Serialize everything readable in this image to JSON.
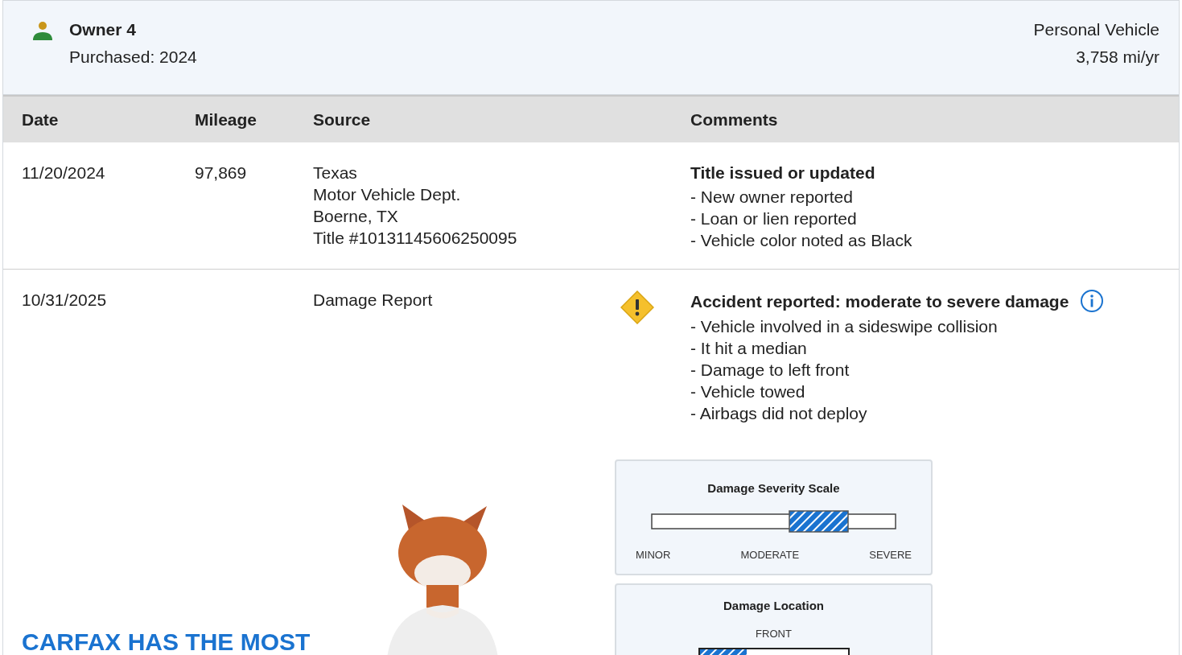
{
  "owner": {
    "title": "Owner 4",
    "purchased": "Purchased: 2024",
    "usage": "Personal Vehicle",
    "mileage_rate": "3,758 mi/yr"
  },
  "table": {
    "columns": [
      "Date",
      "Mileage",
      "Source",
      "Comments"
    ],
    "rows": [
      {
        "date": "11/20/2024",
        "mileage": "97,869",
        "source": [
          "Texas",
          "Motor Vehicle Dept.",
          "Boerne, TX",
          "Title #10131145606250095"
        ],
        "headline": "Title issued or updated",
        "details": [
          "- New owner reported",
          "- Loan or lien reported",
          "- Vehicle color noted as Black"
        ]
      },
      {
        "date": "10/31/2025",
        "source": [
          "Damage Report"
        ],
        "alert": true,
        "info": true,
        "headline": "Accident reported: moderate to severe damage",
        "details": [
          "- Vehicle involved in a sideswipe collision",
          "- It hit a median",
          "- Damage to left front",
          "- Vehicle towed",
          "- Airbags did not deploy"
        ],
        "severity": {
          "title": "Damage Severity Scale",
          "labels": [
            "MINOR",
            "MODERATE",
            "SEVERE"
          ]
        },
        "location": {
          "title": "Damage Location",
          "label": "FRONT"
        }
      }
    ]
  },
  "promo": {
    "headline": "CARFAX HAS THE MOST"
  }
}
